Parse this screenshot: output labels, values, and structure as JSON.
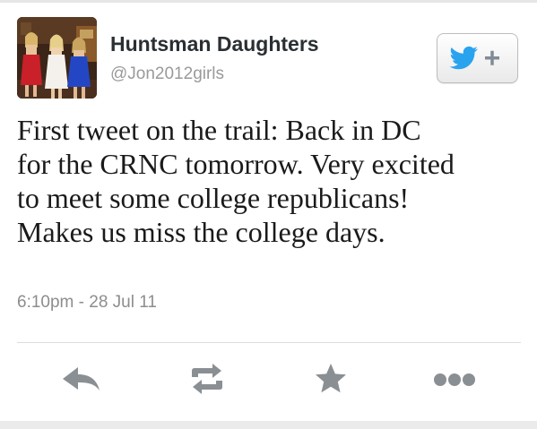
{
  "profile": {
    "display_name": "Huntsman Daughters",
    "handle": "@Jon2012girls"
  },
  "follow_button": {
    "icon": "twitter-bird-plus-icon",
    "bird_color": "#2aa3ef"
  },
  "tweet": {
    "lines": [
      "First tweet on the trail: Back in DC",
      "for the CRNC tomorrow. Very excited",
      "to meet some college republicans!",
      "Makes us miss the college days."
    ],
    "timestamp": "6:10pm - 28 Jul 11"
  },
  "actions": [
    {
      "name": "reply",
      "icon": "reply-icon"
    },
    {
      "name": "retweet",
      "icon": "retweet-icon"
    },
    {
      "name": "favorite",
      "icon": "star-icon"
    },
    {
      "name": "more",
      "icon": "more-dots-icon"
    }
  ],
  "colors": {
    "name_text": "#292f33",
    "secondary_text": "#8d8d8d",
    "action_icon": "#8a8f94"
  }
}
